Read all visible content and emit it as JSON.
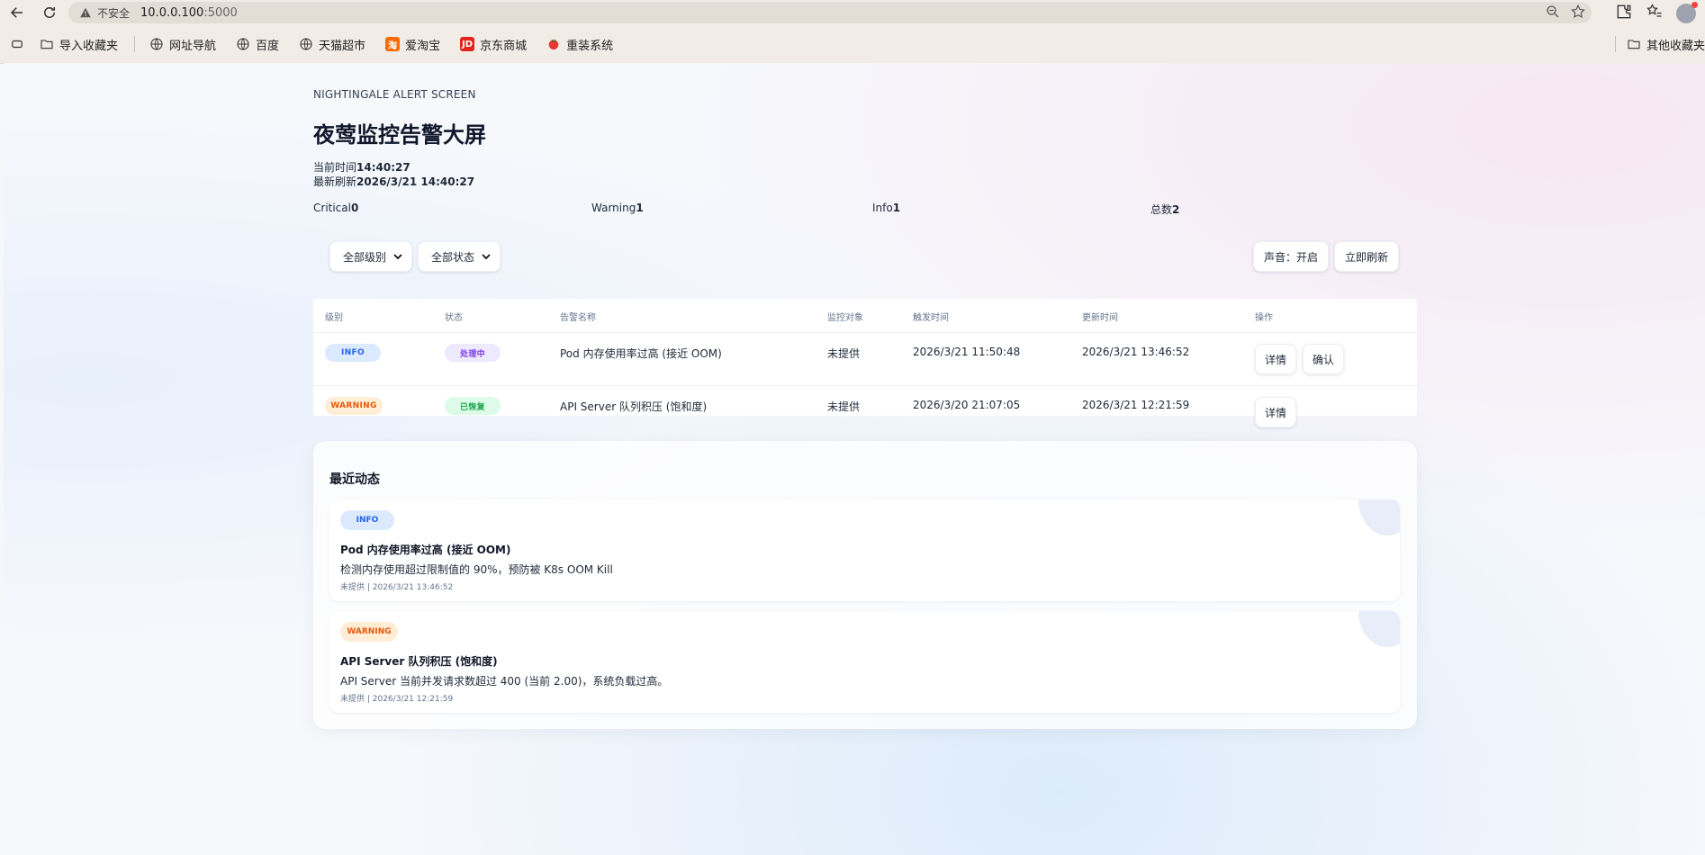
{
  "browser": {
    "insecure_label": "不安全",
    "url_host": "10.0.0.100",
    "url_port": ":5000",
    "bookmarks": [
      {
        "label": "导入收藏夹",
        "icon": "folder-import-icon"
      },
      {
        "label": "网址导航",
        "icon": "globe-icon"
      },
      {
        "label": "百度",
        "icon": "globe-icon"
      },
      {
        "label": "天猫超市",
        "icon": "globe-icon"
      },
      {
        "label": "爱淘宝",
        "icon": "taobao-icon"
      },
      {
        "label": "京东商城",
        "icon": "jd-icon"
      },
      {
        "label": "重装系统",
        "icon": "tomato-icon"
      }
    ],
    "other_bookmarks": "其他收藏夹"
  },
  "header": {
    "eyebrow": "NIGHTINGALE ALERT SCREEN",
    "title": "夜莺监控告警大屏",
    "current_time_label": "当前时间",
    "current_time": "14:40:27",
    "last_refresh_label": "最新刷新",
    "last_refresh": "2026/3/21 14:40:27"
  },
  "counts": {
    "critical_label": "Critical",
    "critical": "0",
    "warning_label": "Warning",
    "warning": "1",
    "info_label": "Info",
    "info": "1",
    "total_label": "总数",
    "total": "2"
  },
  "filters": {
    "level": "全部级别",
    "status": "全部状态"
  },
  "toolbar": {
    "sound": "声音：开启",
    "refresh": "立即刷新"
  },
  "table": {
    "headers": [
      "级别",
      "状态",
      "告警名称",
      "监控对象",
      "触发时间",
      "更新时间",
      "操作"
    ],
    "rows": [
      {
        "level": "INFO",
        "status": "处理中",
        "name": "Pod 内存使用率过高 (接近 OOM)",
        "target": "未提供",
        "triggered": "2026/3/21 11:50:48",
        "updated": "2026/3/21 13:46:52",
        "actions": [
          "详情",
          "确认"
        ]
      },
      {
        "level": "WARNING",
        "status": "已恢复",
        "name": "API Server 队列积压 (饱和度)",
        "target": "未提供",
        "triggered": "2026/3/20 21:07:05",
        "updated": "2026/3/21 12:21:59",
        "actions": [
          "详情"
        ]
      }
    ]
  },
  "activity": {
    "title": "最近动态",
    "items": [
      {
        "level": "INFO",
        "name": "Pod 内存使用率过高 (接近 OOM)",
        "desc": "检测内存使用超过限制值的 90%，预防被 K8s OOM Kill",
        "meta": "未提供 | 2026/3/21 13:46:52"
      },
      {
        "level": "WARNING",
        "name": "API Server 队列积压 (饱和度)",
        "desc": "API Server 当前并发请求数超过 400 (当前 2.00)，系统负载过高。",
        "meta": "未提供 | 2026/3/21 12:21:59"
      }
    ]
  },
  "colors": {
    "info": "#2563eb",
    "info_bg": "#dbeafe",
    "warning": "#ea580c",
    "warning_bg": "#ffedd5",
    "processing": "#7c3aed",
    "recovered": "#16a34a"
  }
}
